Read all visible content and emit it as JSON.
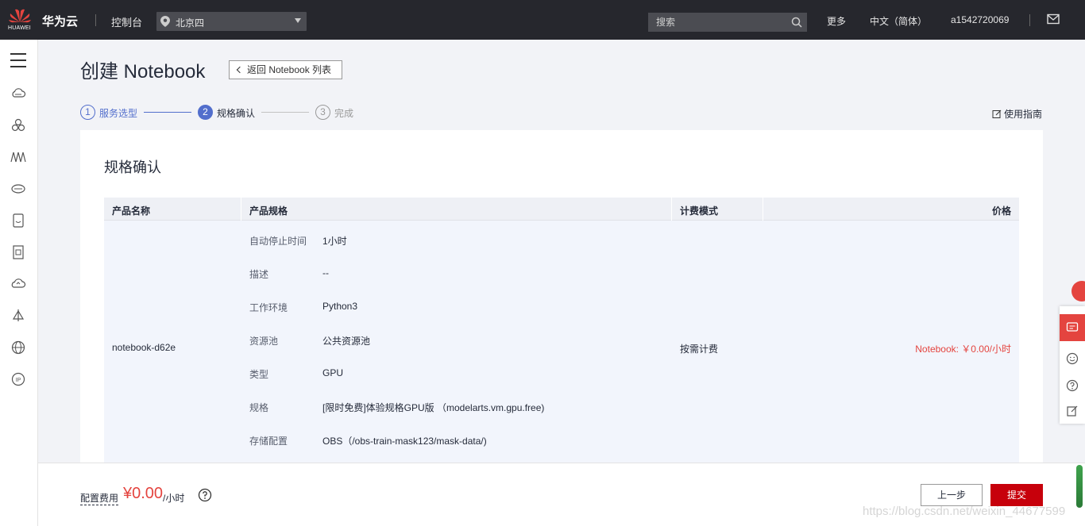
{
  "topbar": {
    "logo_text": "HUAWEI",
    "brand": "华为云",
    "console": "控制台",
    "region": "北京四",
    "search_placeholder": "搜索",
    "more": "更多",
    "language": "中文（简体）",
    "username": "a1542720069",
    "accent_color": "#c7000b"
  },
  "sidebar": {
    "icons": [
      "menu-icon",
      "cloud-icon",
      "cluster-icon",
      "ai-icon",
      "storage-icon",
      "database-icon",
      "server-icon",
      "cloud-service-icon",
      "deploy-icon",
      "global-network-icon",
      "ip-icon"
    ]
  },
  "header": {
    "title": "创建 Notebook",
    "back_label": "返回 Notebook 列表",
    "guide_label": "使用指南"
  },
  "steps": [
    {
      "num": "1",
      "label": "服务选型",
      "state": "done"
    },
    {
      "num": "2",
      "label": "规格确认",
      "state": "active"
    },
    {
      "num": "3",
      "label": "完成",
      "state": "pending"
    }
  ],
  "card": {
    "title": "规格确认",
    "columns": [
      "产品名称",
      "产品规格",
      "计费模式",
      "价格"
    ],
    "product_name": "notebook-d62e",
    "billing_mode": "按需计费",
    "price": "Notebook: ￥0.00/小时",
    "specs": [
      {
        "label": "自动停止时间",
        "value": "1小时"
      },
      {
        "label": "描述",
        "value": "--"
      },
      {
        "label": "工作环境",
        "value": "Python3"
      },
      {
        "label": "资源池",
        "value": "公共资源池"
      },
      {
        "label": "类型",
        "value": "GPU"
      },
      {
        "label": "规格",
        "value": "[限时免费]体验规格GPU版 （modelarts.vm.gpu.free)"
      },
      {
        "label": "存储配置",
        "value": "OBS（/obs-train-mask123/mask-data/)"
      }
    ]
  },
  "footer": {
    "config_label": "配置费用",
    "config_value": "¥0.00",
    "config_unit": "/小时",
    "prev_label": "上一步",
    "submit_label": "提交",
    "watermark": "https://blog.csdn.net/weixin_44677599"
  }
}
